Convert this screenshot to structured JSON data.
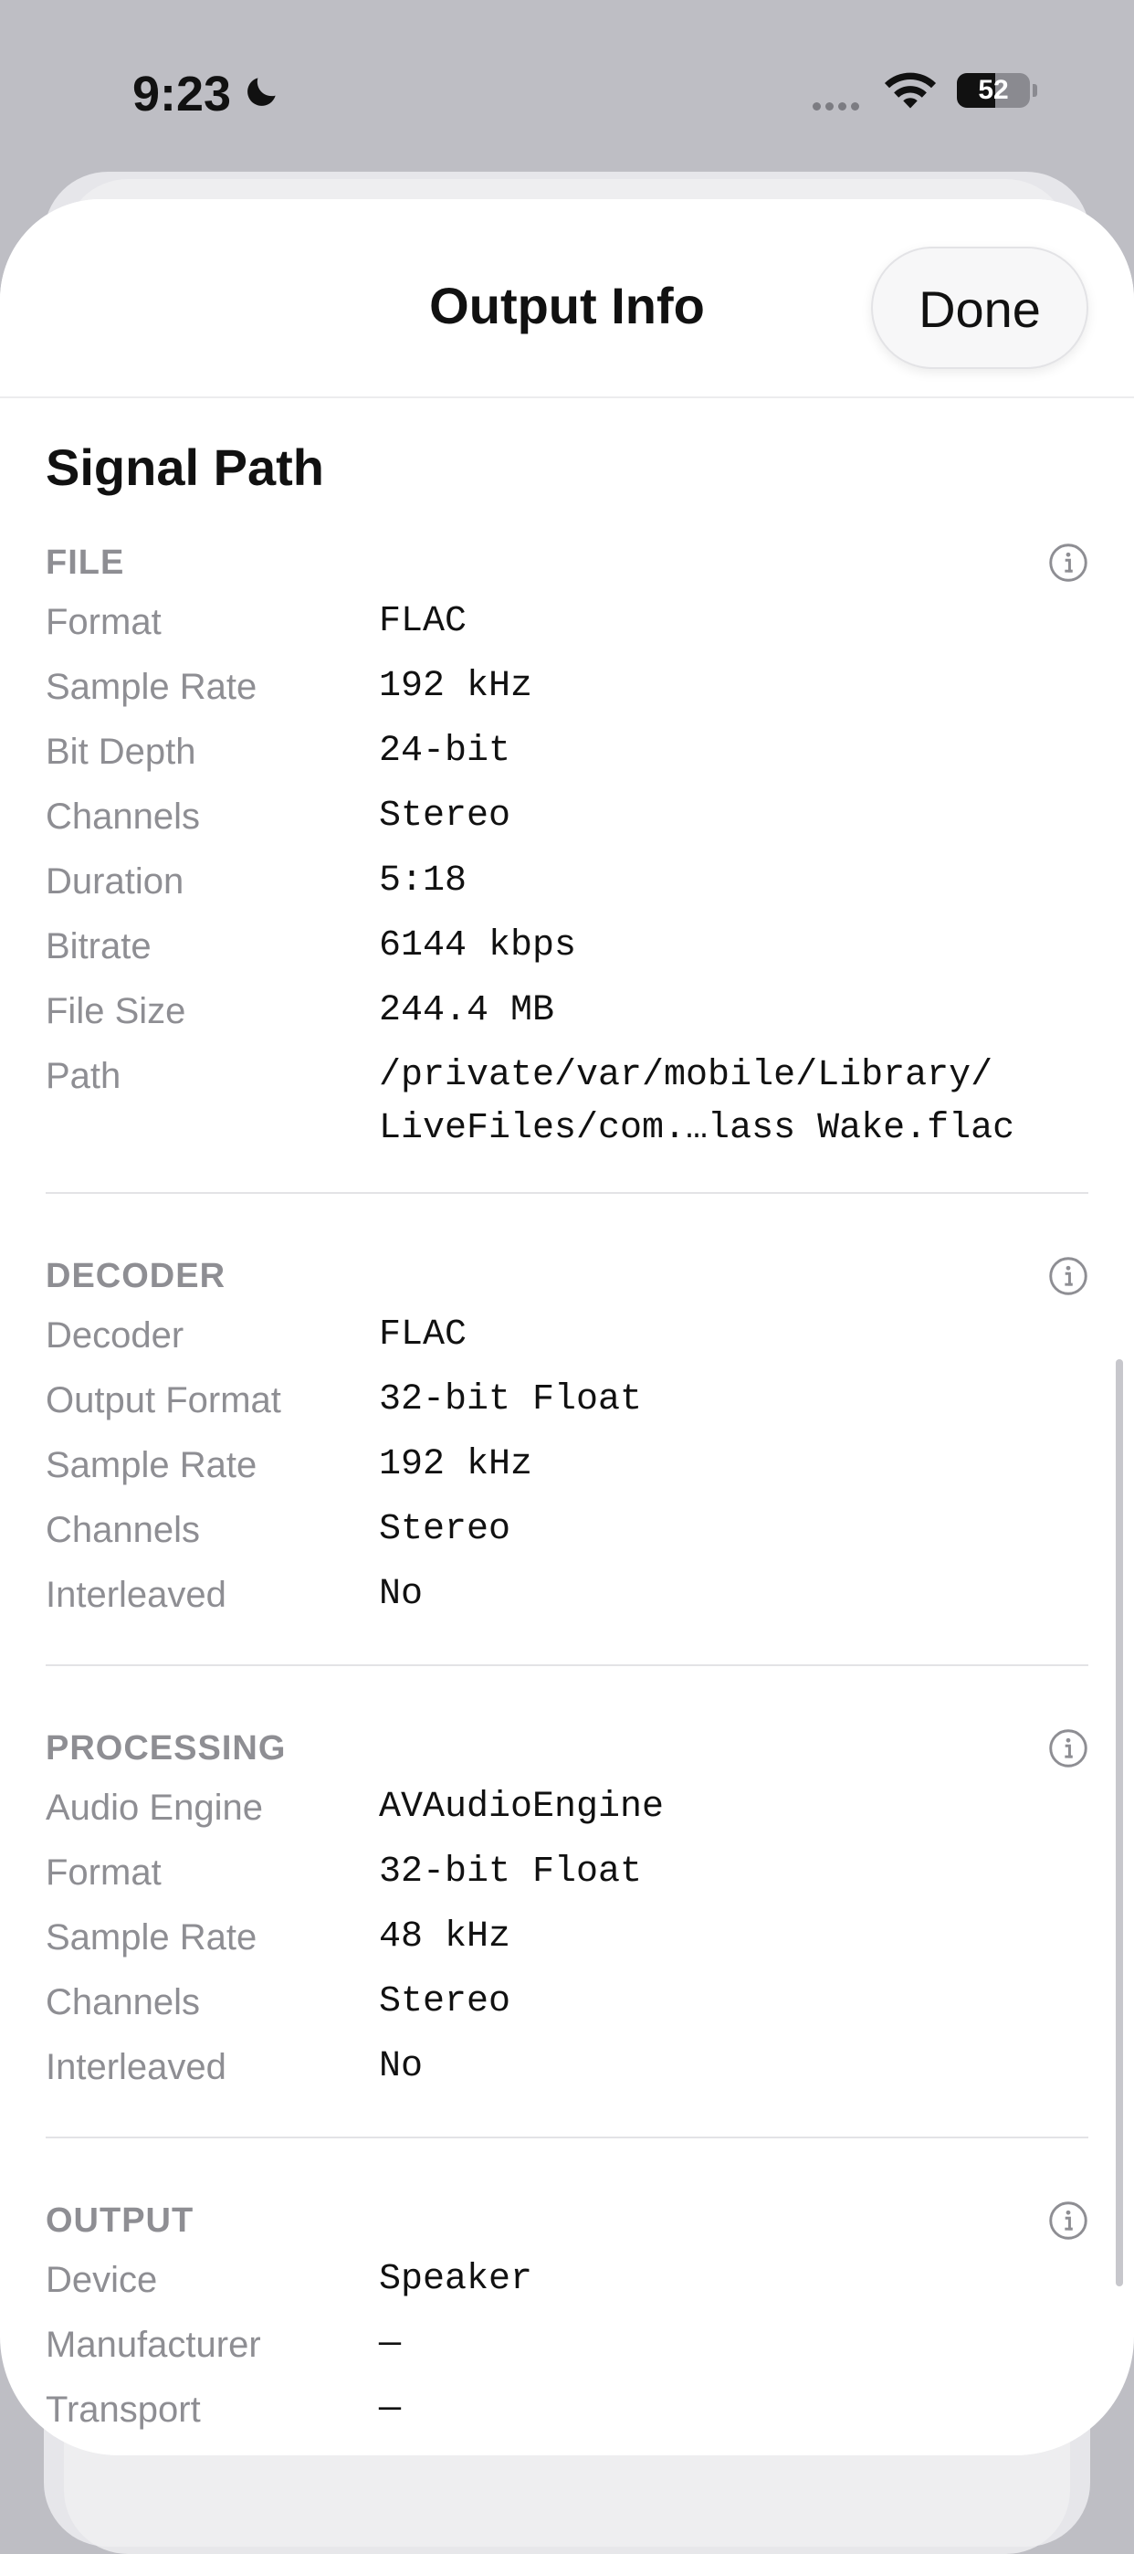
{
  "status_bar": {
    "time": "9:23",
    "battery": "52"
  },
  "sheet": {
    "title": "Output Info",
    "done_label": "Done"
  },
  "section_title": "Signal Path",
  "file": {
    "title": "FILE",
    "rows": [
      {
        "label": "Format",
        "value": "FLAC"
      },
      {
        "label": "Sample Rate",
        "value": "192 kHz"
      },
      {
        "label": "Bit Depth",
        "value": "24-bit"
      },
      {
        "label": "Channels",
        "value": "Stereo"
      },
      {
        "label": "Duration",
        "value": "5:18"
      },
      {
        "label": "Bitrate",
        "value": "6144 kbps"
      },
      {
        "label": "File Size",
        "value": "244.4 MB"
      },
      {
        "label": "Path",
        "value": "/private/var/mobile/Library/\nLiveFiles/com.…lass Wake.flac"
      }
    ]
  },
  "decoder": {
    "title": "DECODER",
    "rows": [
      {
        "label": "Decoder",
        "value": "FLAC"
      },
      {
        "label": "Output Format",
        "value": "32-bit Float"
      },
      {
        "label": "Sample Rate",
        "value": "192 kHz"
      },
      {
        "label": "Channels",
        "value": "Stereo"
      },
      {
        "label": "Interleaved",
        "value": "No"
      }
    ]
  },
  "processing": {
    "title": "PROCESSING",
    "rows": [
      {
        "label": "Audio Engine",
        "value": "AVAudioEngine"
      },
      {
        "label": "Format",
        "value": "32-bit Float"
      },
      {
        "label": "Sample Rate",
        "value": "48 kHz"
      },
      {
        "label": "Channels",
        "value": "Stereo"
      },
      {
        "label": "Interleaved",
        "value": "No"
      }
    ]
  },
  "output": {
    "title": "OUTPUT",
    "rows": [
      {
        "label": "Device",
        "value": "Speaker"
      },
      {
        "label": "Manufacturer",
        "value": "—"
      },
      {
        "label": "Transport",
        "value": "—"
      }
    ]
  }
}
